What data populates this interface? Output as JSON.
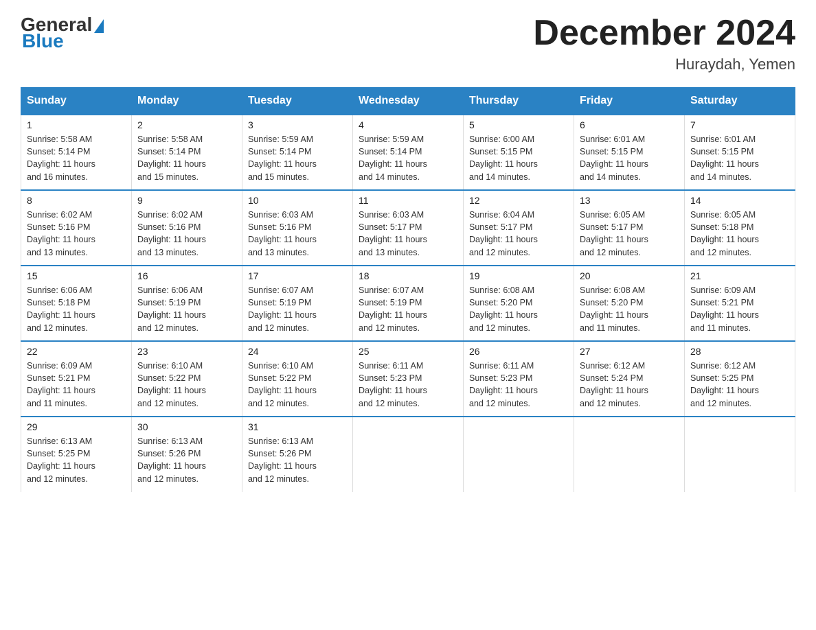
{
  "logo": {
    "general": "General",
    "blue": "Blue"
  },
  "header": {
    "month_title": "December 2024",
    "location": "Huraydah, Yemen"
  },
  "weekdays": [
    "Sunday",
    "Monday",
    "Tuesday",
    "Wednesday",
    "Thursday",
    "Friday",
    "Saturday"
  ],
  "weeks": [
    [
      {
        "day": "1",
        "sunrise": "5:58 AM",
        "sunset": "5:14 PM",
        "daylight": "11 hours and 16 minutes."
      },
      {
        "day": "2",
        "sunrise": "5:58 AM",
        "sunset": "5:14 PM",
        "daylight": "11 hours and 15 minutes."
      },
      {
        "day": "3",
        "sunrise": "5:59 AM",
        "sunset": "5:14 PM",
        "daylight": "11 hours and 15 minutes."
      },
      {
        "day": "4",
        "sunrise": "5:59 AM",
        "sunset": "5:14 PM",
        "daylight": "11 hours and 14 minutes."
      },
      {
        "day": "5",
        "sunrise": "6:00 AM",
        "sunset": "5:15 PM",
        "daylight": "11 hours and 14 minutes."
      },
      {
        "day": "6",
        "sunrise": "6:01 AM",
        "sunset": "5:15 PM",
        "daylight": "11 hours and 14 minutes."
      },
      {
        "day": "7",
        "sunrise": "6:01 AM",
        "sunset": "5:15 PM",
        "daylight": "11 hours and 14 minutes."
      }
    ],
    [
      {
        "day": "8",
        "sunrise": "6:02 AM",
        "sunset": "5:16 PM",
        "daylight": "11 hours and 13 minutes."
      },
      {
        "day": "9",
        "sunrise": "6:02 AM",
        "sunset": "5:16 PM",
        "daylight": "11 hours and 13 minutes."
      },
      {
        "day": "10",
        "sunrise": "6:03 AM",
        "sunset": "5:16 PM",
        "daylight": "11 hours and 13 minutes."
      },
      {
        "day": "11",
        "sunrise": "6:03 AM",
        "sunset": "5:17 PM",
        "daylight": "11 hours and 13 minutes."
      },
      {
        "day": "12",
        "sunrise": "6:04 AM",
        "sunset": "5:17 PM",
        "daylight": "11 hours and 12 minutes."
      },
      {
        "day": "13",
        "sunrise": "6:05 AM",
        "sunset": "5:17 PM",
        "daylight": "11 hours and 12 minutes."
      },
      {
        "day": "14",
        "sunrise": "6:05 AM",
        "sunset": "5:18 PM",
        "daylight": "11 hours and 12 minutes."
      }
    ],
    [
      {
        "day": "15",
        "sunrise": "6:06 AM",
        "sunset": "5:18 PM",
        "daylight": "11 hours and 12 minutes."
      },
      {
        "day": "16",
        "sunrise": "6:06 AM",
        "sunset": "5:19 PM",
        "daylight": "11 hours and 12 minutes."
      },
      {
        "day": "17",
        "sunrise": "6:07 AM",
        "sunset": "5:19 PM",
        "daylight": "11 hours and 12 minutes."
      },
      {
        "day": "18",
        "sunrise": "6:07 AM",
        "sunset": "5:19 PM",
        "daylight": "11 hours and 12 minutes."
      },
      {
        "day": "19",
        "sunrise": "6:08 AM",
        "sunset": "5:20 PM",
        "daylight": "11 hours and 12 minutes."
      },
      {
        "day": "20",
        "sunrise": "6:08 AM",
        "sunset": "5:20 PM",
        "daylight": "11 hours and 11 minutes."
      },
      {
        "day": "21",
        "sunrise": "6:09 AM",
        "sunset": "5:21 PM",
        "daylight": "11 hours and 11 minutes."
      }
    ],
    [
      {
        "day": "22",
        "sunrise": "6:09 AM",
        "sunset": "5:21 PM",
        "daylight": "11 hours and 11 minutes."
      },
      {
        "day": "23",
        "sunrise": "6:10 AM",
        "sunset": "5:22 PM",
        "daylight": "11 hours and 12 minutes."
      },
      {
        "day": "24",
        "sunrise": "6:10 AM",
        "sunset": "5:22 PM",
        "daylight": "11 hours and 12 minutes."
      },
      {
        "day": "25",
        "sunrise": "6:11 AM",
        "sunset": "5:23 PM",
        "daylight": "11 hours and 12 minutes."
      },
      {
        "day": "26",
        "sunrise": "6:11 AM",
        "sunset": "5:23 PM",
        "daylight": "11 hours and 12 minutes."
      },
      {
        "day": "27",
        "sunrise": "6:12 AM",
        "sunset": "5:24 PM",
        "daylight": "11 hours and 12 minutes."
      },
      {
        "day": "28",
        "sunrise": "6:12 AM",
        "sunset": "5:25 PM",
        "daylight": "11 hours and 12 minutes."
      }
    ],
    [
      {
        "day": "29",
        "sunrise": "6:13 AM",
        "sunset": "5:25 PM",
        "daylight": "11 hours and 12 minutes."
      },
      {
        "day": "30",
        "sunrise": "6:13 AM",
        "sunset": "5:26 PM",
        "daylight": "11 hours and 12 minutes."
      },
      {
        "day": "31",
        "sunrise": "6:13 AM",
        "sunset": "5:26 PM",
        "daylight": "11 hours and 12 minutes."
      },
      null,
      null,
      null,
      null
    ]
  ],
  "labels": {
    "sunrise": "Sunrise:",
    "sunset": "Sunset:",
    "daylight": "Daylight:"
  }
}
